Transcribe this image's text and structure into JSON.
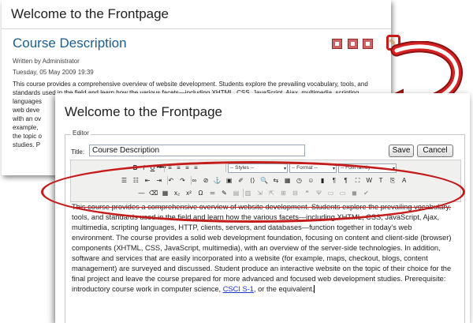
{
  "back": {
    "site_title": "Welcome to the Frontpage",
    "course_title": "Course Description",
    "written_by": "Written by Administrator",
    "date": "Tuesday, 05 May 2009 19:39",
    "body_lines": [
      "This course provides a comprehensive overview of website development. Students explore the prevailing vocabulary, tools, and",
      "standards used in the field and learn how the various facets—including XHTML, CSS, JavaScript, Ajax, multimedia, scripting",
      "languages",
      "web deve",
      "with an ov",
      "example,",
      "the topic o",
      "studies. P"
    ],
    "icons": [
      "pdf-icon",
      "print-icon",
      "email-icon"
    ]
  },
  "front": {
    "site_title": "Welcome to the Frontpage",
    "legend": "Editor",
    "title_label": "Title:",
    "title_value": "Course Description",
    "save_label": "Save",
    "cancel_label": "Cancel",
    "styles_select": "-- Styles --",
    "format_select": "-- Format --",
    "font_select": "-- Font family --",
    "content_lines": [
      "This course provides a comprehensive overview of website development. Students explore the prevailing vocabulary,",
      "tools, and standards used in the field and learn how the various facets—including XHTML, CSS, JavaScript, Ajax,",
      "multimedia, scripting languages, HTTP, clients, servers, and databases—function together in today's web",
      "environment. The course provides a solid web development foundation, focusing on content and client-side (browser)",
      "components (XHTML, CSS, JavaScript, multimedia), with an overview of the server-side technologies. In addition,",
      "software and services that are easily incorporated into a website (for example, maps, checkout, blogs, content",
      "management) are surveyed and discussed. Student produce an interactive website on the topic of their choice for the",
      "final project and leave the course prepared for more advanced and focused web development studies. Prerequisite:",
      "introductory course work in computer science, "
    ],
    "link_text": "CSCI S-1",
    "end_text": ", or the equivalent."
  },
  "toolbar": {
    "row1": [
      {
        "name": "bold-icon",
        "g": "B"
      },
      {
        "name": "italic-icon",
        "g": "I"
      },
      {
        "name": "underline-icon",
        "g": "U"
      },
      {
        "name": "strikethrough-icon",
        "g": "ABC"
      },
      {
        "name": "align-left-icon",
        "g": "≡"
      },
      {
        "name": "align-center-icon",
        "g": "≡"
      },
      {
        "name": "align-right-icon",
        "g": "≡"
      },
      {
        "name": "align-justify-icon",
        "g": "≡"
      }
    ],
    "row2": [
      {
        "name": "bullet-list-icon",
        "g": "☰"
      },
      {
        "name": "numbered-list-icon",
        "g": "☷"
      },
      {
        "name": "outdent-icon",
        "g": "⇤"
      },
      {
        "name": "indent-icon",
        "g": "⇥"
      },
      {
        "name": "undo-icon",
        "g": "↶"
      },
      {
        "name": "redo-icon",
        "g": "↷"
      },
      {
        "name": "link-icon",
        "g": "∞"
      },
      {
        "name": "unlink-icon",
        "g": "⊘"
      },
      {
        "name": "anchor-icon",
        "g": "⚓"
      },
      {
        "name": "image-icon",
        "g": "▣"
      },
      {
        "name": "cleanup-icon",
        "g": "✐"
      },
      {
        "name": "html-icon",
        "g": "⟨⟩"
      },
      {
        "name": "find-icon",
        "g": "🔍"
      },
      {
        "name": "replace-icon",
        "g": "⇆"
      },
      {
        "name": "table-icon",
        "g": "▦"
      },
      {
        "name": "insert-date-icon",
        "g": "◷"
      },
      {
        "name": "emoticon-icon",
        "g": "☺"
      },
      {
        "name": "media-icon",
        "g": "▮"
      },
      {
        "name": "ltr-icon",
        "g": "¶"
      },
      {
        "name": "rtl-icon",
        "g": "¶"
      },
      {
        "name": "fullscreen-icon",
        "g": "⛶"
      },
      {
        "name": "paste-word-icon",
        "g": "W"
      },
      {
        "name": "paste-text-icon",
        "g": "T"
      },
      {
        "name": "copy-icon",
        "g": "⎘"
      },
      {
        "name": "text-color-icon",
        "g": "A"
      }
    ],
    "row3": [
      {
        "name": "horizontal-rule-icon",
        "g": "—"
      },
      {
        "name": "remove-format-icon",
        "g": "⌫"
      },
      {
        "name": "visual-aid-icon",
        "g": "▦"
      },
      {
        "name": "subscript-icon",
        "g": "x₂"
      },
      {
        "name": "superscript-icon",
        "g": "x²"
      },
      {
        "name": "special-char-icon",
        "g": "Ω"
      },
      {
        "name": "hr-icon",
        "g": "═"
      },
      {
        "name": "edit-icon",
        "g": "✎"
      },
      {
        "name": "layer-icon",
        "g": "▤"
      },
      {
        "name": "layer-abs-icon",
        "g": "▥"
      },
      {
        "name": "move-back-icon",
        "g": "⇲"
      },
      {
        "name": "move-front-icon",
        "g": "⇱"
      },
      {
        "name": "pagebreak-icon",
        "g": "⊞"
      },
      {
        "name": "template-icon",
        "g": "⊟"
      },
      {
        "name": "cite-icon",
        "g": "❝"
      },
      {
        "name": "abbr-icon",
        "g": "Ψ"
      },
      {
        "name": "attribs-icon",
        "g": "▭"
      },
      {
        "name": "nonbreaking-icon",
        "g": "▭"
      },
      {
        "name": "preview-icon",
        "g": "◼"
      },
      {
        "name": "spellcheck-icon",
        "g": "✔"
      }
    ]
  }
}
